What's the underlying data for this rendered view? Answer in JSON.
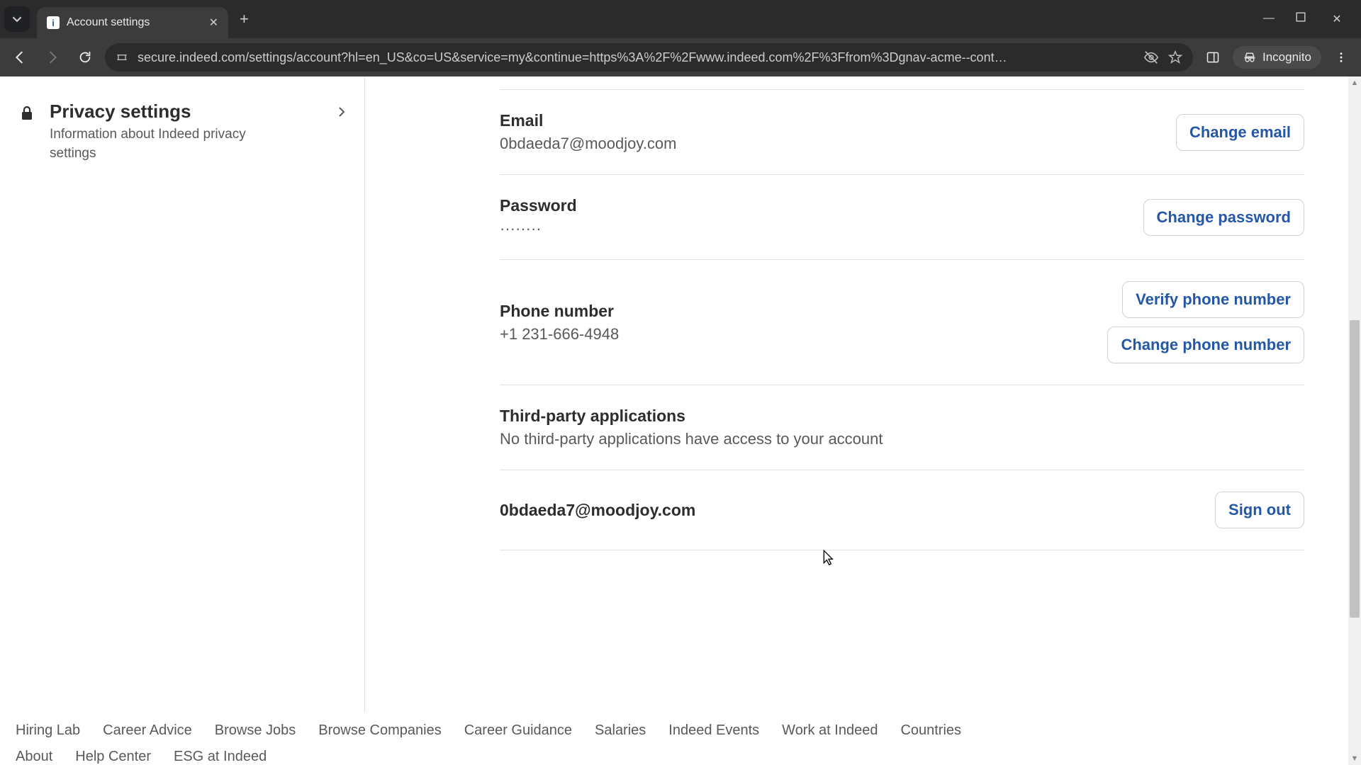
{
  "browser": {
    "tab_title": "Account settings",
    "url": "secure.indeed.com/settings/account?hl=en_US&co=US&service=my&continue=https%3A%2F%2Fwww.indeed.com%2F%3Ffrom%3Dgnav-acme--cont…",
    "incognito_label": "Incognito"
  },
  "sidebar": {
    "privacy": {
      "title": "Privacy settings",
      "desc": "Information about Indeed privacy settings"
    }
  },
  "account": {
    "email": {
      "label": "Email",
      "value": "0bdaeda7@moodjoy.com",
      "change": "Change email"
    },
    "password": {
      "label": "Password",
      "value": "········",
      "change": "Change password"
    },
    "phone": {
      "label": "Phone number",
      "value": "+1 231-666-4948",
      "verify": "Verify phone number",
      "change": "Change phone number"
    },
    "thirdparty": {
      "label": "Third-party applications",
      "value": "No third-party applications have access to your account"
    },
    "signout": {
      "email": "0bdaeda7@moodjoy.com",
      "button": "Sign out"
    }
  },
  "footer": {
    "row1": [
      "Hiring Lab",
      "Career Advice",
      "Browse Jobs",
      "Browse Companies",
      "Career Guidance",
      "Salaries",
      "Indeed Events",
      "Work at Indeed",
      "Countries"
    ],
    "row2": [
      "About",
      "Help Center",
      "ESG at Indeed"
    ]
  }
}
